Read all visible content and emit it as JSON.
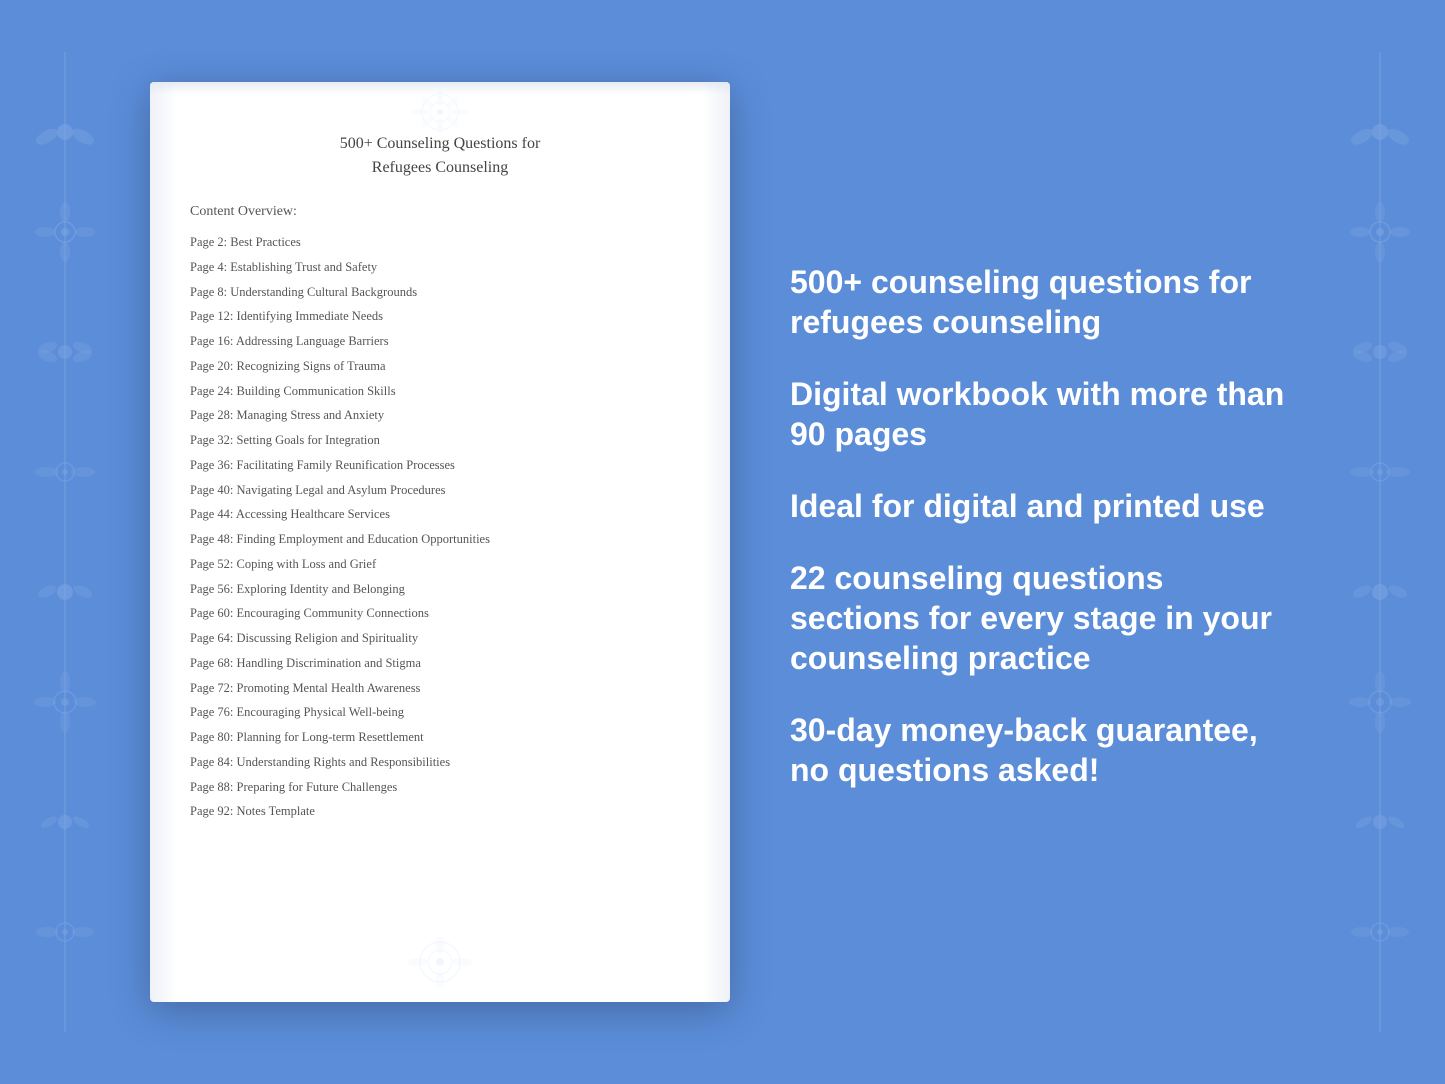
{
  "background_color": "#5b8dd9",
  "document": {
    "title_line1": "500+ Counseling Questions for",
    "title_line2": "Refugees Counseling",
    "content_overview_label": "Content Overview:",
    "toc_items": [
      {
        "page": "Page  2:",
        "topic": "Best Practices"
      },
      {
        "page": "Page  4:",
        "topic": "Establishing Trust and Safety"
      },
      {
        "page": "Page  8:",
        "topic": "Understanding Cultural Backgrounds"
      },
      {
        "page": "Page 12:",
        "topic": "Identifying Immediate Needs"
      },
      {
        "page": "Page 16:",
        "topic": "Addressing Language Barriers"
      },
      {
        "page": "Page 20:",
        "topic": "Recognizing Signs of Trauma"
      },
      {
        "page": "Page 24:",
        "topic": "Building Communication Skills"
      },
      {
        "page": "Page 28:",
        "topic": "Managing Stress and Anxiety"
      },
      {
        "page": "Page 32:",
        "topic": "Setting Goals for Integration"
      },
      {
        "page": "Page 36:",
        "topic": "Facilitating Family Reunification Processes"
      },
      {
        "page": "Page 40:",
        "topic": "Navigating Legal and Asylum Procedures"
      },
      {
        "page": "Page 44:",
        "topic": "Accessing Healthcare Services"
      },
      {
        "page": "Page 48:",
        "topic": "Finding Employment and Education Opportunities"
      },
      {
        "page": "Page 52:",
        "topic": "Coping with Loss and Grief"
      },
      {
        "page": "Page 56:",
        "topic": "Exploring Identity and Belonging"
      },
      {
        "page": "Page 60:",
        "topic": "Encouraging Community Connections"
      },
      {
        "page": "Page 64:",
        "topic": "Discussing Religion and Spirituality"
      },
      {
        "page": "Page 68:",
        "topic": "Handling Discrimination and Stigma"
      },
      {
        "page": "Page 72:",
        "topic": "Promoting Mental Health Awareness"
      },
      {
        "page": "Page 76:",
        "topic": "Encouraging Physical Well-being"
      },
      {
        "page": "Page 80:",
        "topic": "Planning for Long-term Resettlement"
      },
      {
        "page": "Page 84:",
        "topic": "Understanding Rights and Responsibilities"
      },
      {
        "page": "Page 88:",
        "topic": "Preparing for Future Challenges"
      },
      {
        "page": "Page 92:",
        "topic": "Notes Template"
      }
    ]
  },
  "features": [
    {
      "id": "feature1",
      "text": "500+ counseling questions for refugees counseling"
    },
    {
      "id": "feature2",
      "text": "Digital workbook with more than 90 pages"
    },
    {
      "id": "feature3",
      "text": "Ideal for digital and printed use"
    },
    {
      "id": "feature4",
      "text": "22 counseling questions sections for every stage in your counseling practice"
    },
    {
      "id": "feature5",
      "text": "30-day money-back guarantee, no questions asked!"
    }
  ]
}
